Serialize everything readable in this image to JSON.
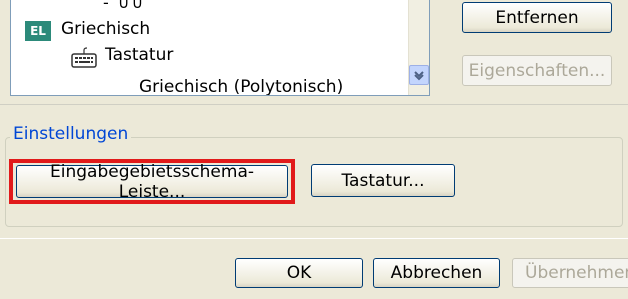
{
  "list": {
    "cutoff_text": "- ∪∪",
    "lang_badge": "EL",
    "language": "Griechisch",
    "keyboard_label": "Tastatur",
    "layout_partial": "Griechisch (Polytonisch)"
  },
  "buttons": {
    "remove": "Entfernen",
    "properties": "Eigenschaften..."
  },
  "settings": {
    "title": "Einstellungen",
    "language_bar": "Eingabegebietsschema-Leiste...",
    "keyboard": "Tastatur..."
  },
  "footer": {
    "ok": "OK",
    "cancel": "Abbrechen",
    "apply": "Übernehmen"
  },
  "colors": {
    "highlight": "#e11a1a",
    "group_title": "#0046d5",
    "badge": "#2c8a7a"
  },
  "icons": [
    "keyboard-icon",
    "chevron-down-icon"
  ]
}
